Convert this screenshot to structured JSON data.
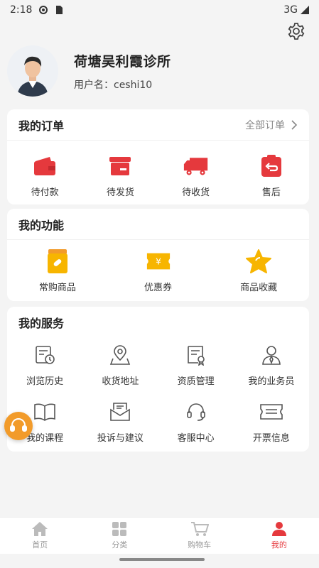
{
  "status_bar": {
    "time": "2:18",
    "network": "3G"
  },
  "profile": {
    "shop_name": "荷塘吴利霞诊所",
    "username_label": "用户名：",
    "username": "ceshi10"
  },
  "orders": {
    "title": "我的订单",
    "all_link": "全部订单",
    "items": [
      {
        "label": "待付款",
        "icon": "wallet-icon"
      },
      {
        "label": "待发货",
        "icon": "box-icon"
      },
      {
        "label": "待收货",
        "icon": "truck-icon"
      },
      {
        "label": "售后",
        "icon": "return-icon"
      }
    ]
  },
  "functions": {
    "title": "我的功能",
    "items": [
      {
        "label": "常购商品",
        "icon": "medicine-bag-icon"
      },
      {
        "label": "优惠券",
        "icon": "coupon-icon"
      },
      {
        "label": "商品收藏",
        "icon": "star-icon"
      }
    ]
  },
  "services": {
    "title": "我的服务",
    "items": [
      {
        "label": "浏览历史",
        "icon": "history-icon"
      },
      {
        "label": "收货地址",
        "icon": "location-icon"
      },
      {
        "label": "资质管理",
        "icon": "certificate-icon"
      },
      {
        "label": "我的业务员",
        "icon": "salesperson-icon"
      },
      {
        "label": "我的课程",
        "icon": "book-icon"
      },
      {
        "label": "投诉与建议",
        "icon": "complaint-icon"
      },
      {
        "label": "客服中心",
        "icon": "headset-icon"
      },
      {
        "label": "开票信息",
        "icon": "invoice-icon"
      }
    ]
  },
  "tabbar": {
    "items": [
      {
        "label": "首页",
        "icon": "home-icon"
      },
      {
        "label": "分类",
        "icon": "category-icon"
      },
      {
        "label": "购物车",
        "icon": "cart-icon"
      },
      {
        "label": "我的",
        "icon": "user-icon",
        "active": true
      }
    ]
  },
  "colors": {
    "accent": "#e5393d",
    "orange": "#f29b2a",
    "yellow": "#f7b500"
  }
}
